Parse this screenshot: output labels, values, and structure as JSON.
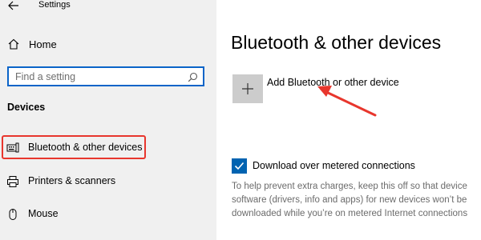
{
  "window": {
    "title": "Settings"
  },
  "sidebar": {
    "home_label": "Home",
    "search_placeholder": "Find a setting",
    "section_title": "Devices",
    "items": [
      {
        "label": "Bluetooth & other devices",
        "icon": "bluetooth-devices-icon"
      },
      {
        "label": "Printers & scanners",
        "icon": "printer-icon"
      },
      {
        "label": "Mouse",
        "icon": "mouse-icon"
      }
    ]
  },
  "main": {
    "title": "Bluetooth & other devices",
    "add_device_label": "Add Bluetooth or other device",
    "metered_checkbox_label": "Download over metered connections",
    "metered_checked": true,
    "description_lines": [
      "To help prevent extra charges, keep this off so that device",
      "software (drivers, info and apps) for new devices won’t be",
      "downloaded while you’re on metered Internet connections"
    ]
  },
  "colors": {
    "accent": "#0063b1",
    "annotation_red": "#e8362d",
    "sidebar_bg": "#f0f0f0"
  }
}
